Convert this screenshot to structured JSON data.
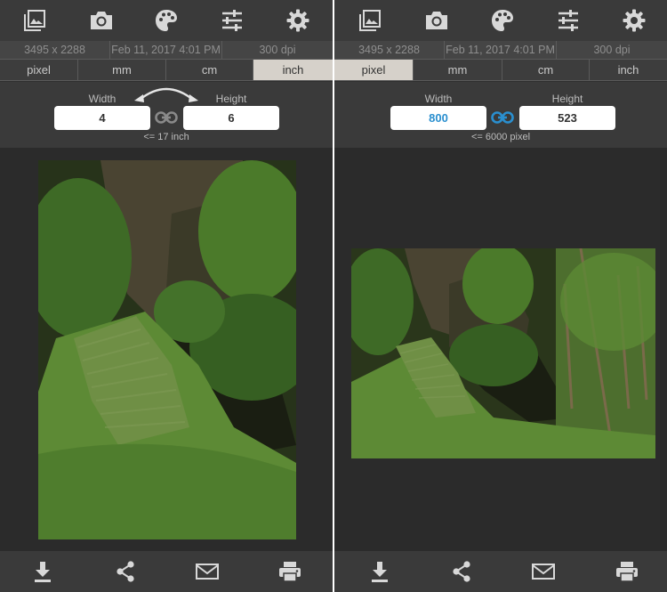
{
  "screens": [
    {
      "meta": {
        "dimensions": "3495 x 2288",
        "date": "Feb 11, 2017 4:01 PM",
        "dpi": "300 dpi"
      },
      "units": [
        "pixel",
        "mm",
        "cm",
        "inch"
      ],
      "selected_unit": "inch",
      "width_label": "Width",
      "height_label": "Height",
      "width_value": "4",
      "height_value": "6",
      "limit_text": "<= 17 inch",
      "aspect_locked": false
    },
    {
      "meta": {
        "dimensions": "3495 x 2288",
        "date": "Feb 11, 2017 4:01 PM",
        "dpi": "300 dpi"
      },
      "units": [
        "pixel",
        "mm",
        "cm",
        "inch"
      ],
      "selected_unit": "pixel",
      "width_label": "Width",
      "height_label": "Height",
      "width_value": "800",
      "height_value": "523",
      "limit_text": "<= 6000 pixel",
      "aspect_locked": true
    }
  ],
  "toolbar_icons": [
    "gallery-icon",
    "camera-icon",
    "palette-icon",
    "sliders-icon",
    "gear-icon"
  ],
  "bottom_icons": [
    "download-icon",
    "share-icon",
    "mail-icon",
    "print-icon"
  ],
  "colors": {
    "accent": "#2a8fcf",
    "selected_unit_bg": "#d6d1ca",
    "bar_bg": "#3a3a3a",
    "panel_bg": "#2f2f2f"
  }
}
